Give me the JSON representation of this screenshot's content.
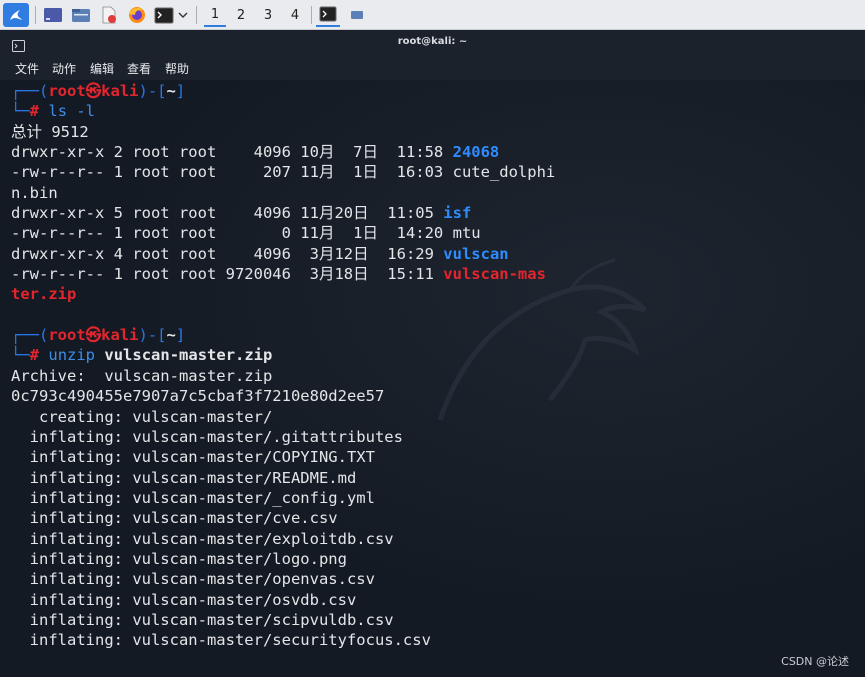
{
  "taskbar": {
    "workspaces": [
      "1",
      "2",
      "3",
      "4"
    ]
  },
  "window": {
    "title": "root@kali: ~",
    "menu": [
      "文件",
      "动作",
      "编辑",
      "查看",
      "帮助"
    ]
  },
  "prompt": {
    "user": "root",
    "at": "㉿",
    "host": "kali",
    "dir": "~",
    "symbol": "#"
  },
  "session": {
    "cmd1": "ls -l",
    "total": "总计 9512",
    "rows": [
      {
        "meta": "drwxr-xr-x 2 root root    4096 10月  7日  11:58 ",
        "name": "24068"
      },
      {
        "meta": "-rw-r--r-- 1 root root     207 11月  1日  16:03 ",
        "name": "cute_dolphi"
      },
      {
        "meta": "",
        "name": "n.bin"
      },
      {
        "meta": "drwxr-xr-x 5 root root    4096 11月20日  11:05 ",
        "name": "isf"
      },
      {
        "meta": "-rw-r--r-- 1 root root       0 11月  1日  14:20 ",
        "name": "mtu"
      },
      {
        "meta": "drwxr-xr-x 4 root root    4096  3月12日  16:29 ",
        "name": "vulscan"
      },
      {
        "meta": "-rw-r--r-- 1 root root 9720046  3月18日  15:11 ",
        "name": "vulscan-mas"
      },
      {
        "meta": "",
        "name": "ter.zip"
      }
    ],
    "cmd2_name": "unzip",
    "cmd2_arg": "vulscan-master.zip",
    "archive": "Archive:  vulscan-master.zip",
    "hash": "0c793c490455e7907a7c5cbaf3f7210e80d2ee57",
    "output": [
      "   creating: vulscan-master/",
      "  inflating: vulscan-master/.gitattributes",
      "  inflating: vulscan-master/COPYING.TXT",
      "  inflating: vulscan-master/README.md",
      "  inflating: vulscan-master/_config.yml",
      "  inflating: vulscan-master/cve.csv",
      "  inflating: vulscan-master/exploitdb.csv",
      "  inflating: vulscan-master/logo.png",
      "  inflating: vulscan-master/openvas.csv",
      "  inflating: vulscan-master/osvdb.csv",
      "  inflating: vulscan-master/scipvuldb.csv",
      "  inflating: vulscan-master/securityfocus.csv"
    ]
  },
  "watermark": "CSDN @论述",
  "colors": {
    "prompt_blue": "#2c75e6",
    "prompt_red": "#e5252e",
    "dir_blue": "#2f8cff",
    "zip_red": "#e5252e",
    "terminal_bg": "#141a23"
  }
}
